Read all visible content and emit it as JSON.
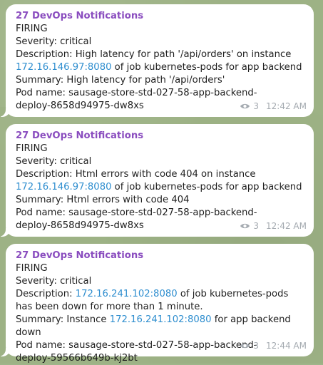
{
  "messages": [
    {
      "sender": "27 DevOps Notifications",
      "status": "FIRING",
      "severity": "Severity: critical",
      "desc_pre": "Description: High latency for path '/api/orders' on instance",
      "desc_link": "172.16.146.97:8080",
      "desc_post": " of job kubernetes-pods for app backend",
      "summary_pre": "Summary: High latency for path '/api/orders'",
      "summary_link": "",
      "summary_post": "",
      "pod_1": "Pod name: sausage-store-std-027-58-app-backend-",
      "pod_2": "deploy-8658d94975-dw8xs",
      "views": "3",
      "time": "12:42 AM"
    },
    {
      "sender": "27 DevOps Notifications",
      "status": "FIRING",
      "severity": "Severity: critical",
      "desc_pre": "Description: Html errors with code 404 on instance",
      "desc_link": "172.16.146.97:8080",
      "desc_post": " of job kubernetes-pods for app backend",
      "summary_pre": "Summary: Html errors with code 404",
      "summary_link": "",
      "summary_post": "",
      "pod_1": "Pod name: sausage-store-std-027-58-app-backend-",
      "pod_2": "deploy-8658d94975-dw8xs",
      "views": "3",
      "time": "12:42 AM"
    },
    {
      "sender": "27 DevOps Notifications",
      "status": "FIRING",
      "severity": "Severity: critical",
      "desc_pre": "Description: ",
      "desc_link": "172.16.241.102:8080",
      "desc_post": " of job kubernetes-pods has been down for more than 1 minute.",
      "summary_pre": "Summary: Instance ",
      "summary_link": "172.16.241.102:8080",
      "summary_post": " for app backend down",
      "pod_1": "Pod name: sausage-store-std-027-58-app-backend-",
      "pod_2": "deploy-59566b649b-kj2bt",
      "views": "3",
      "time": "12:44 AM"
    }
  ]
}
